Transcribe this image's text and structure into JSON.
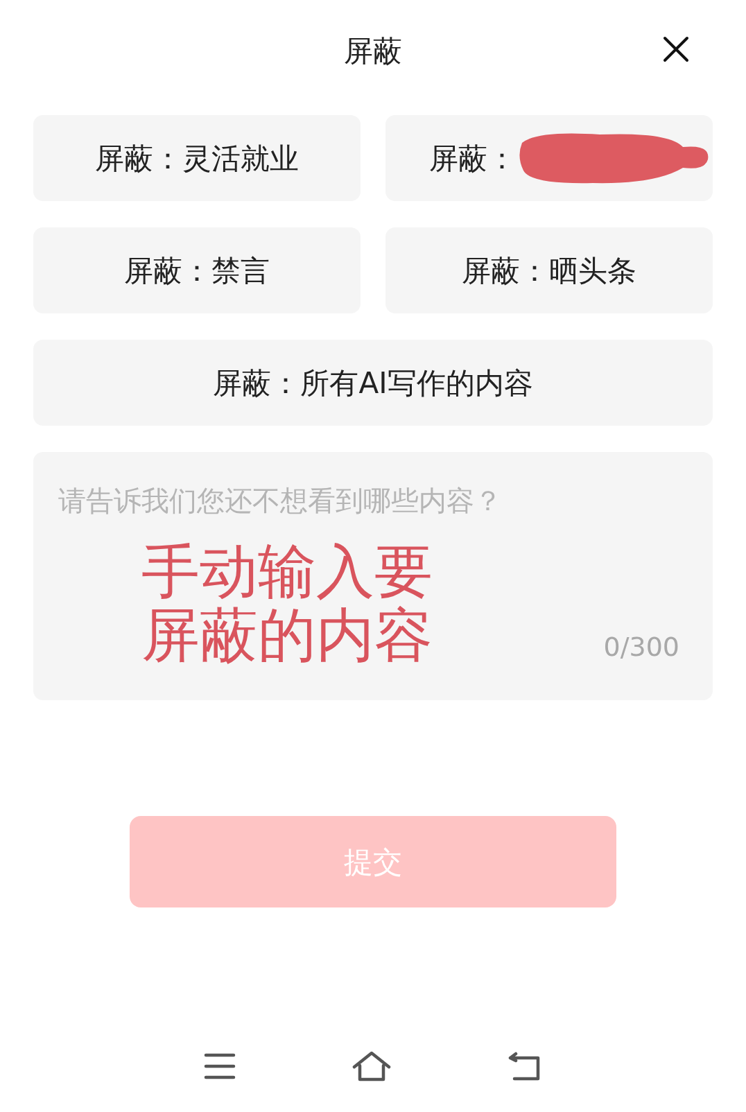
{
  "sheet": {
    "title": "屏蔽"
  },
  "chips": [
    {
      "kind": "text",
      "prefix": "屏蔽：",
      "value": "灵活就业",
      "wide": false
    },
    {
      "kind": "redacted",
      "prefix": "屏蔽：",
      "wide": false
    },
    {
      "kind": "text",
      "prefix": "屏蔽：",
      "value": "禁言",
      "wide": false
    },
    {
      "kind": "text",
      "prefix": "屏蔽：",
      "value": "晒头条",
      "wide": false
    },
    {
      "kind": "text",
      "prefix": "屏蔽：",
      "value": "所有AI写作的内容",
      "wide": true
    }
  ],
  "input": {
    "placeholder": "请告诉我们您还不想看到哪些内容？",
    "counter": "0/300"
  },
  "annotation": [
    "手动输入要",
    "屏蔽的内容"
  ],
  "submit": {
    "label": "提交",
    "disabled": true
  }
}
